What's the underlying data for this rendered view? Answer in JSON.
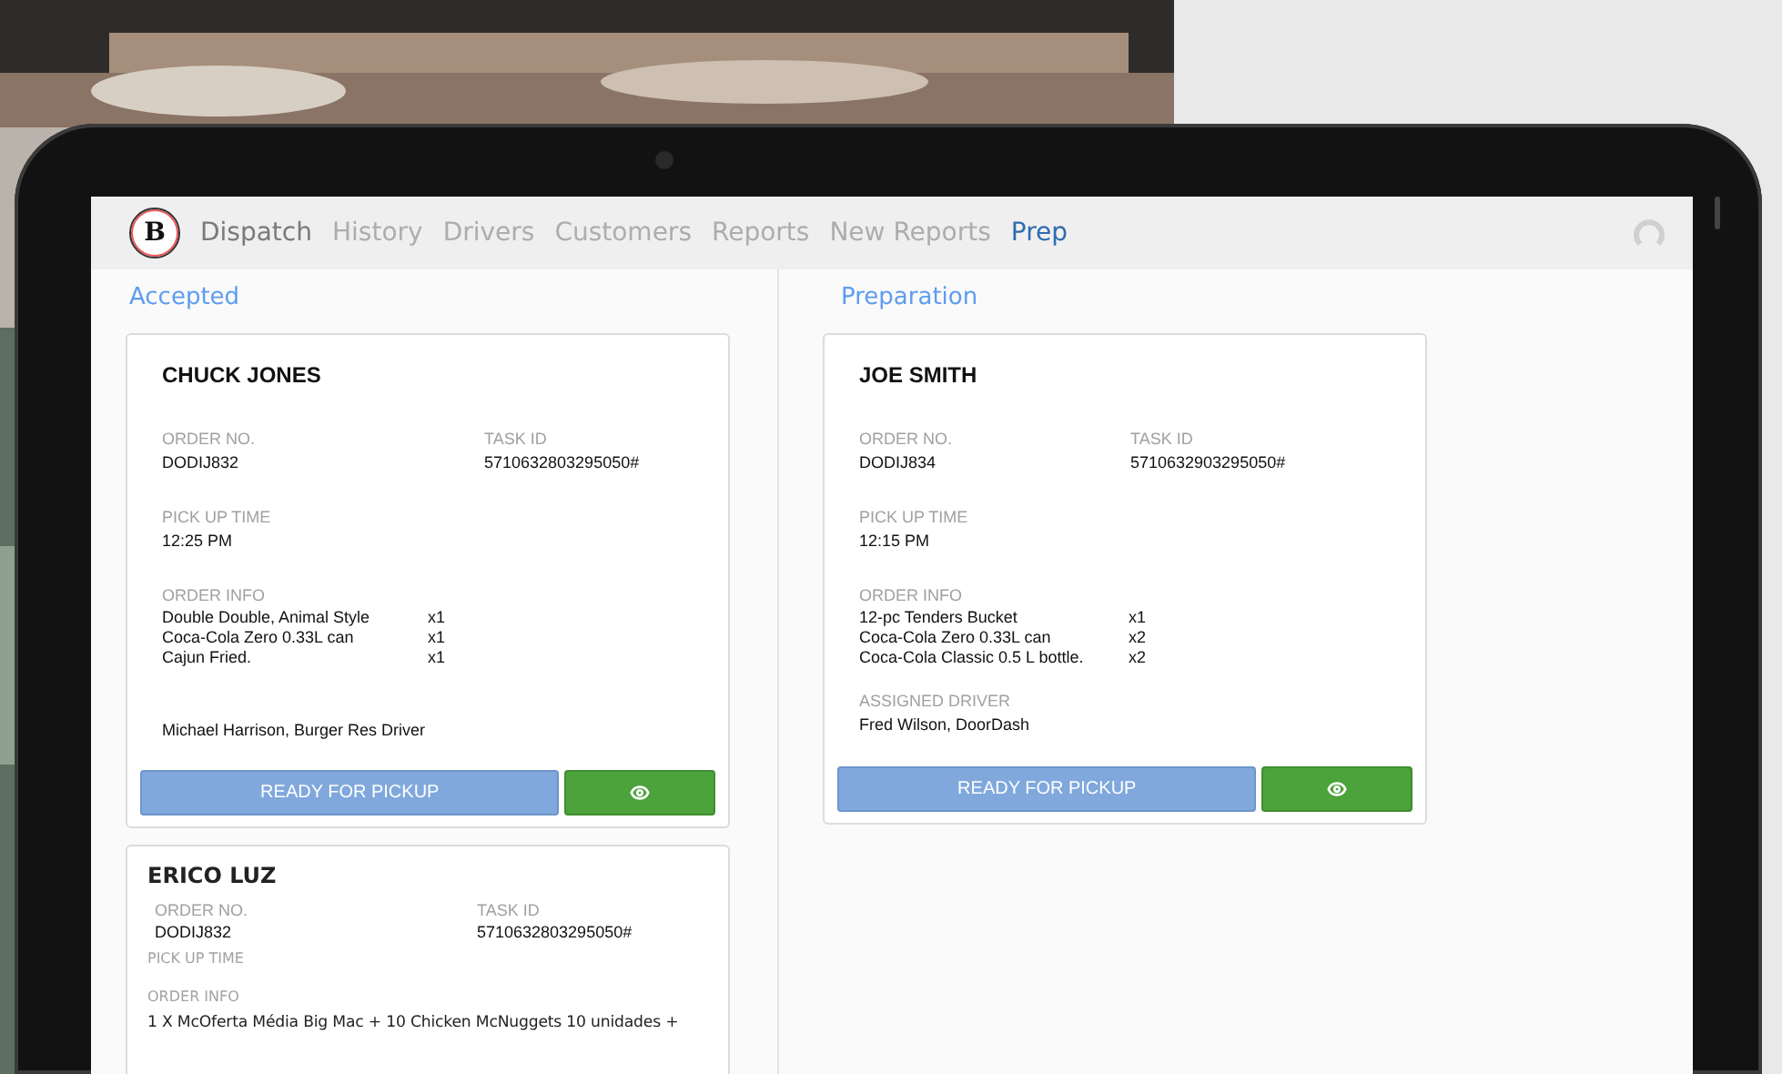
{
  "nav": {
    "logo": "B",
    "items": [
      {
        "label": "Dispatch",
        "selected": false,
        "kind": "home"
      },
      {
        "label": "History",
        "selected": false,
        "kind": "link"
      },
      {
        "label": "Drivers",
        "selected": false,
        "kind": "link"
      },
      {
        "label": "Customers",
        "selected": false,
        "kind": "link"
      },
      {
        "label": "Reports",
        "selected": false,
        "kind": "link"
      },
      {
        "label": "New Reports",
        "selected": false,
        "kind": "link"
      },
      {
        "label": "Prep",
        "selected": true,
        "kind": "link"
      }
    ]
  },
  "columns": [
    {
      "title": "Accepted",
      "cards": [
        {
          "kind": "full",
          "name": "CHUCK JONES",
          "order_label": "ORDER NO.",
          "order_no": "DODIJ832",
          "task_label": "TASK ID",
          "task_id": "5710632803295050#",
          "pickup_label": "PICK UP TIME",
          "pickup_time": "12:25 PM",
          "info_label": "ORDER INFO",
          "items": [
            {
              "name": "Double Double, Animal Style",
              "qty": "x1"
            },
            {
              "name": "Coca-Cola Zero 0.33L can",
              "qty": "x1"
            },
            {
              "name": "Cajun Fried.",
              "qty": "x1"
            }
          ],
          "driver": "Michael Harrison, Burger Res Driver",
          "button": "READY FOR PICKUP"
        },
        {
          "kind": "compact",
          "name": "ERICO LUZ",
          "order_label": "ORDER NO.",
          "order_no": "DODIJ832",
          "task_label": "TASK ID",
          "task_id": "5710632803295050#",
          "pickup_label": "PICK UP TIME",
          "info_label": "ORDER INFO",
          "info_text": "1 X McOferta Média Big Mac + 10 Chicken McNuggets 10 unidades +"
        }
      ]
    },
    {
      "title": "Preparation",
      "cards": [
        {
          "kind": "full",
          "name": "JOE SMITH",
          "order_label": "ORDER NO.",
          "order_no": "DODIJ834",
          "task_label": "TASK ID",
          "task_id": "5710632903295050#",
          "pickup_label": "PICK UP TIME",
          "pickup_time": "12:15 PM",
          "info_label": "ORDER INFO",
          "items": [
            {
              "name": "12-pc Tenders Bucket",
              "qty": "x1"
            },
            {
              "name": "Coca-Cola Zero 0.33L can",
              "qty": "x2"
            },
            {
              "name": "Coca-Cola Classic 0.5 L bottle.",
              "qty": "x2"
            }
          ],
          "driver_label": "ASSIGNED DRIVER",
          "driver": "Fred Wilson, DoorDash",
          "button": "READY FOR PICKUP"
        }
      ]
    }
  ]
}
